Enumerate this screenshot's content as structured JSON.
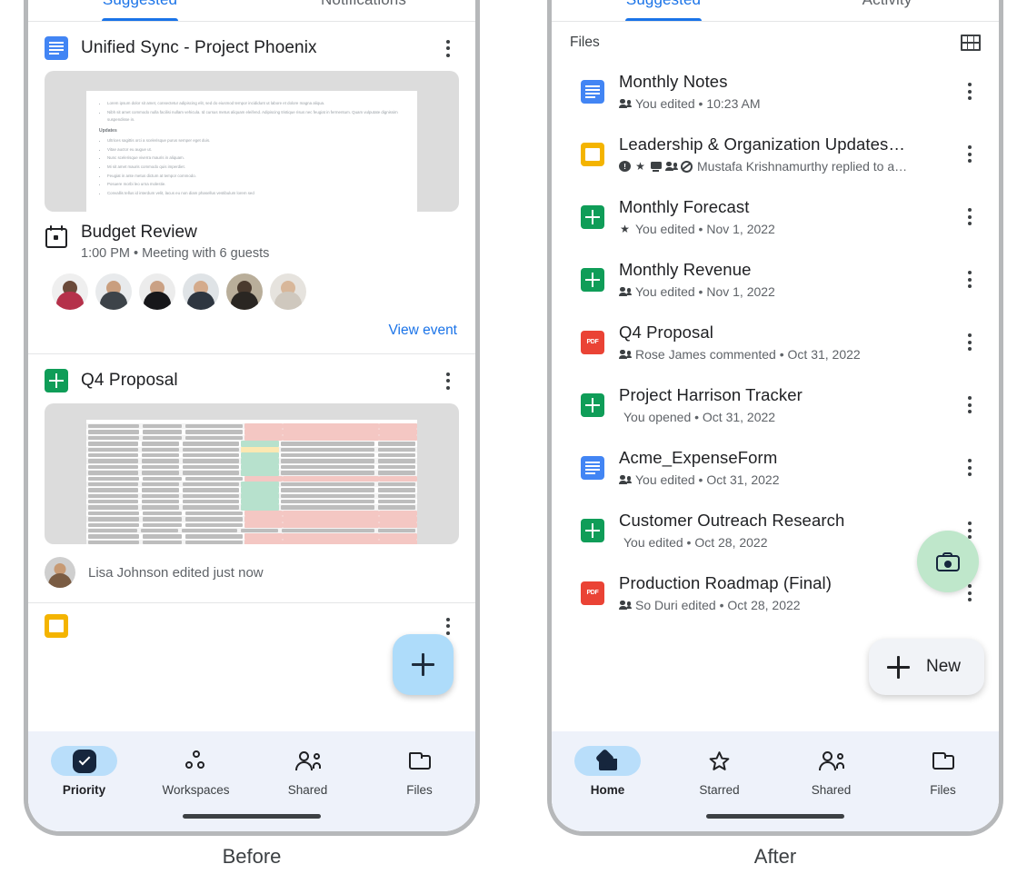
{
  "captions": {
    "left": "Before",
    "right": "After"
  },
  "before": {
    "tabs": [
      {
        "label": "Suggested",
        "active": true
      },
      {
        "label": "Notifications",
        "active": false
      }
    ],
    "cards": [
      {
        "icon": "docs-icon",
        "title": "Unified Sync - Project Phoenix",
        "preview": "document",
        "doc_preview": {
          "bullets_top": [
            "Lorem ipsum dolor sit amet, consectetur adipiscing elit, sed do eiusmod tempor incididunt ut labore et dolore magna aliqua.",
            "Nibh sit amet commodo nulla facilisi nullam vehicula. Id cursus metus aliquam eleifend. Adipiscing tristique risus nec feugiat in fermentum. Quam vulputate dignissim suspendisse in."
          ],
          "heading": "Updates",
          "bullets_bottom": [
            "Ultrices sagittis orci a scelerisque purus semper eget duis.",
            "Vitae auctor eu augue ut.",
            "Nunc scelerisque viverra mauris in aliquam.",
            "Mi sit amet mauris commodo quis imperdiet.",
            "Feugiat in ante metus dictum at tempor commodo.",
            "Posuere morbi leo urna molestie.",
            "Convallis tellus id interdum velit, lacus eu non diam phasellus vestibulum lorem sed"
          ]
        },
        "event": {
          "icon": "calendar-icon",
          "title": "Budget Review",
          "subtitle": "1:00 PM • Meeting with 6 guests",
          "guest_count": 6,
          "action_label": "View event"
        }
      },
      {
        "icon": "sheets-icon",
        "title": "Q4 Proposal",
        "preview": "spreadsheet",
        "attribution": "Lisa Johnson edited just now"
      }
    ],
    "fab": {
      "label": "add-button",
      "icon": "plus-icon",
      "color": "#aedcfa"
    },
    "bottom_nav": [
      {
        "label": "Priority",
        "icon": "check-circle-icon",
        "active": true
      },
      {
        "label": "Workspaces",
        "icon": "workspaces-icon",
        "active": false
      },
      {
        "label": "Shared",
        "icon": "people-icon",
        "active": false
      },
      {
        "label": "Files",
        "icon": "folder-icon",
        "active": false
      }
    ]
  },
  "after": {
    "tabs": [
      {
        "label": "Suggested",
        "active": true
      },
      {
        "label": "Activity",
        "active": false
      }
    ],
    "section_header": {
      "title": "Files",
      "view_toggle_icon": "grid-view-icon"
    },
    "files": [
      {
        "name": "Monthly Notes",
        "icon": "docs-icon",
        "meta": "You edited • 10:23 AM",
        "badges": [
          "people"
        ]
      },
      {
        "name": "Leadership & Organization Updates…",
        "icon": "slides-icon",
        "meta": "Mustafa Krishnamurthy replied to a…",
        "badges": [
          "info",
          "star",
          "screen",
          "people",
          "block"
        ]
      },
      {
        "name": "Monthly Forecast",
        "icon": "sheets-icon",
        "meta": "You edited • Nov 1, 2022",
        "badges": [
          "star"
        ]
      },
      {
        "name": "Monthly Revenue",
        "icon": "sheets-icon",
        "meta": "You edited • Nov 1, 2022",
        "badges": [
          "people"
        ]
      },
      {
        "name": "Q4 Proposal",
        "icon": "pdf-icon",
        "meta": "Rose James commented • Oct 31, 2022",
        "badges": [
          "people"
        ]
      },
      {
        "name": "Project Harrison Tracker",
        "icon": "sheets-icon",
        "meta": "You opened • Oct 31, 2022",
        "badges": []
      },
      {
        "name": "Acme_ExpenseForm",
        "icon": "docs-icon",
        "meta": "You edited • Oct 31, 2022",
        "badges": [
          "people"
        ]
      },
      {
        "name": "Customer Outreach Research",
        "icon": "sheets-icon",
        "meta": "You edited • Oct 28, 2022",
        "badges": []
      },
      {
        "name": "Production Roadmap (Final)",
        "icon": "pdf-icon",
        "meta": "So Duri edited • Oct 28, 2022",
        "badges": [
          "people"
        ]
      }
    ],
    "camera_fab": {
      "label": "scan-button",
      "icon": "camera-icon",
      "color": "#bfe7cb"
    },
    "new_fab": {
      "label": "New",
      "icon": "plus-icon"
    },
    "bottom_nav": [
      {
        "label": "Home",
        "icon": "home-icon",
        "active": true
      },
      {
        "label": "Starred",
        "icon": "star-icon",
        "active": false
      },
      {
        "label": "Shared",
        "icon": "people-icon",
        "active": false
      },
      {
        "label": "Files",
        "icon": "folder-icon",
        "active": false
      }
    ]
  }
}
